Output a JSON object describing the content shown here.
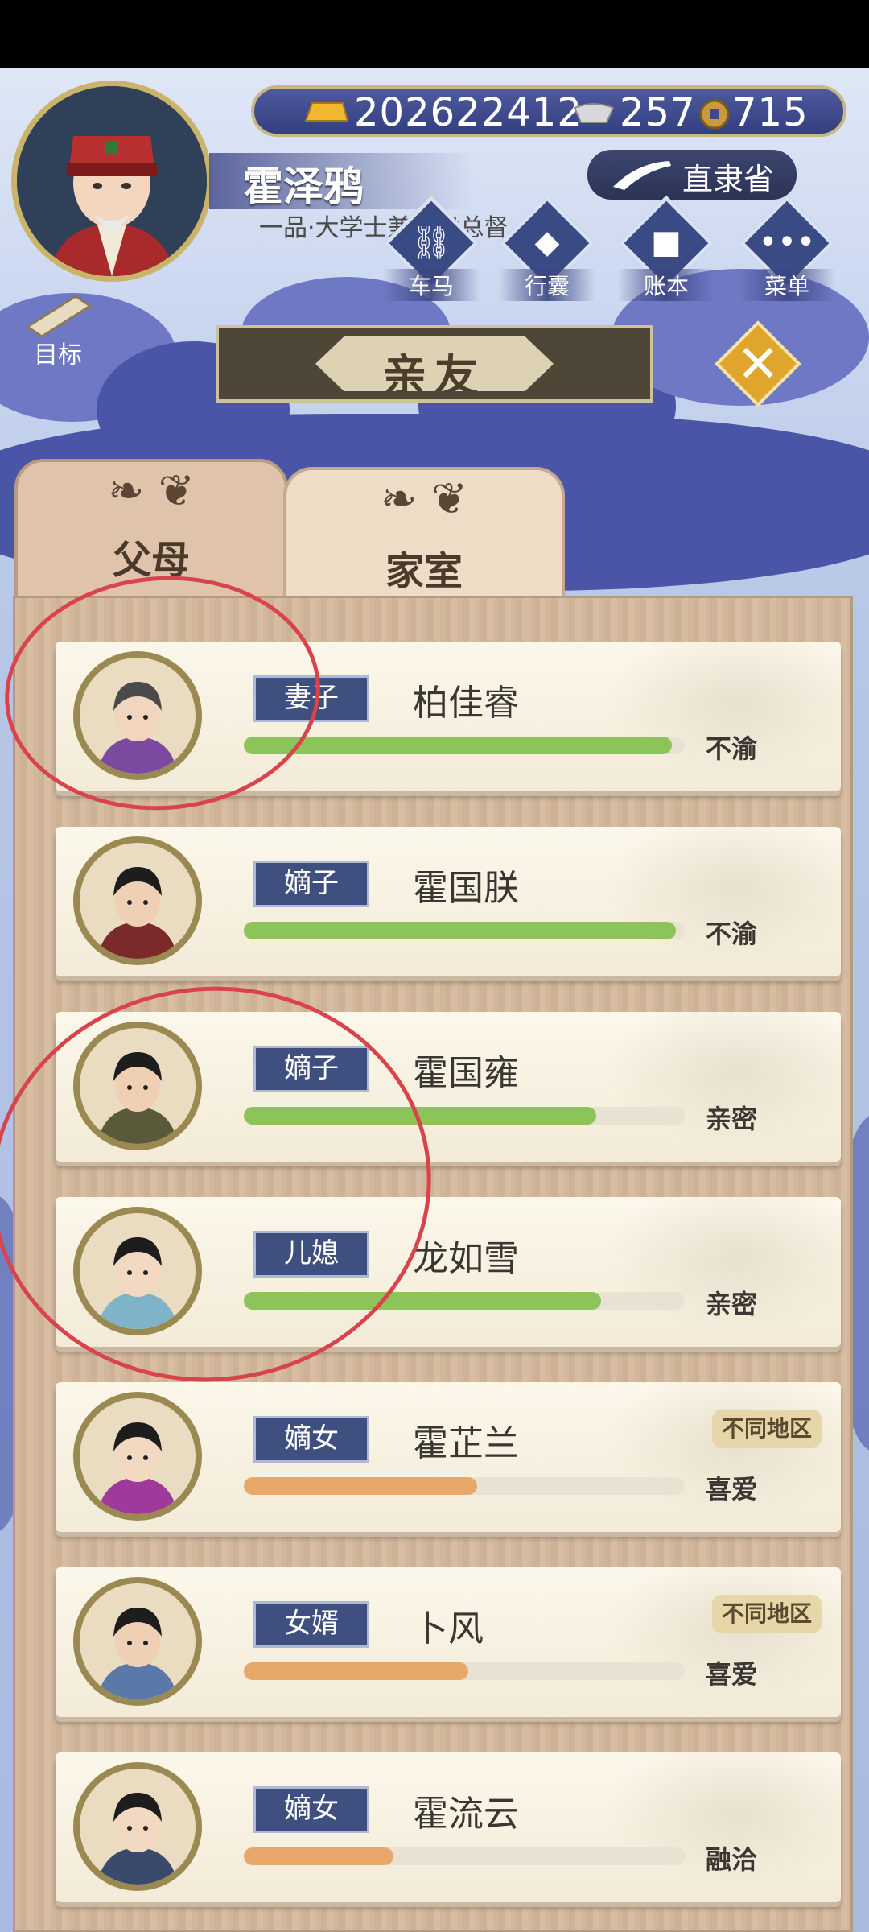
{
  "player": {
    "name": "霍泽鸦",
    "title": "一品·大学士兼直隶总督",
    "province": "直隶省"
  },
  "currency": {
    "gold": "202622412",
    "silver": "257",
    "coin": "715"
  },
  "menu": {
    "items": [
      {
        "label": "车马",
        "icon": "carriage-icon"
      },
      {
        "label": "行囊",
        "icon": "bag-icon"
      },
      {
        "label": "账本",
        "icon": "ledger-icon"
      },
      {
        "label": "菜单",
        "icon": "more-icon"
      }
    ],
    "goal_label": "目标"
  },
  "panel": {
    "title": "亲友",
    "tabs": [
      {
        "label": "父母",
        "active": false
      },
      {
        "label": "家室",
        "active": true
      }
    ]
  },
  "colors": {
    "bar_green": "#8cc45a",
    "bar_orange": "#e8a86a",
    "annotation_red": "#d9434c"
  },
  "members": [
    {
      "role": "妻子",
      "name": "柏佳睿",
      "status": "不渝",
      "affinity": 0.97,
      "bar": "green",
      "region": ""
    },
    {
      "role": "嫡子",
      "name": "霍国朕",
      "status": "不渝",
      "affinity": 0.98,
      "bar": "green",
      "region": ""
    },
    {
      "role": "嫡子",
      "name": "霍国雍",
      "status": "亲密",
      "affinity": 0.8,
      "bar": "green",
      "region": ""
    },
    {
      "role": "儿媳",
      "name": "龙如雪",
      "status": "亲密",
      "affinity": 0.81,
      "bar": "green",
      "region": ""
    },
    {
      "role": "嫡女",
      "name": "霍芷兰",
      "status": "喜爱",
      "affinity": 0.53,
      "bar": "orange",
      "region": "不同地区"
    },
    {
      "role": "女婿",
      "name": "卜风",
      "status": "喜爱",
      "affinity": 0.51,
      "bar": "orange",
      "region": "不同地区"
    },
    {
      "role": "嫡女",
      "name": "霍流云",
      "status": "融洽",
      "affinity": 0.34,
      "bar": "orange",
      "region": ""
    }
  ]
}
